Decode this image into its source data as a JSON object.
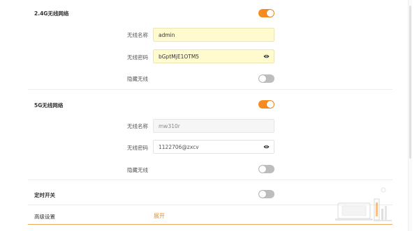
{
  "wifi24": {
    "title": "2.4G无线网络",
    "name_label": "无线名称",
    "name_value": "admin",
    "pwd_label": "无线密码",
    "pwd_value": "bGptMjE1OTM5",
    "hide_label": "隐藏无线",
    "enabled": true,
    "hidden": false
  },
  "wifi5": {
    "title": "5G无线网络",
    "name_label": "无线名称",
    "name_value": "mw310r",
    "pwd_label": "无线密码",
    "pwd_value": "1122706@zxcv",
    "hide_label": "隐藏无线",
    "enabled": true,
    "hidden": false
  },
  "timer": {
    "title": "定时开关",
    "enabled": false
  },
  "advanced": {
    "title": "高级设置",
    "expand_label": "展开"
  },
  "colors": {
    "accent": "#f68b1f",
    "toggle_off": "#bdbdbd",
    "field_highlight": "#fffbcf"
  }
}
